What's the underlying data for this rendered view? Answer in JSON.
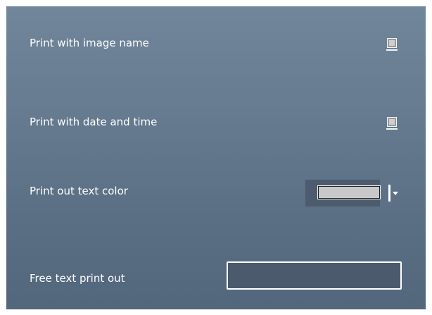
{
  "settings": {
    "print_image_name": {
      "label": "Print with image name",
      "checked": false
    },
    "print_date_time": {
      "label": "Print with date and time",
      "checked": false
    },
    "text_color": {
      "label": "Print out text color",
      "value": "#c8c8c8"
    },
    "free_text": {
      "label": "Free text print out",
      "value": ""
    }
  }
}
